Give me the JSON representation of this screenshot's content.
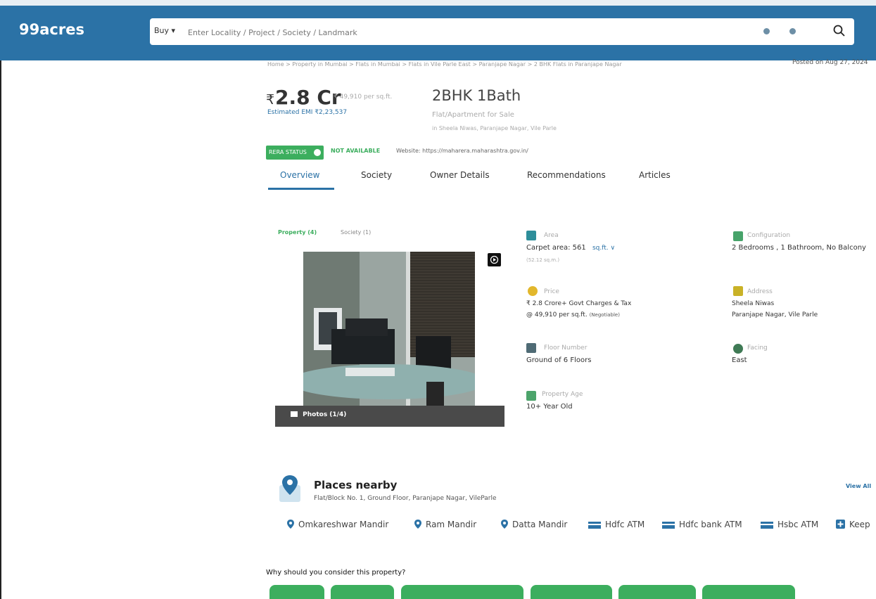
{
  "header": {
    "logo": "99acres",
    "buy_label": "Buy ▾",
    "search_placeholder": "Enter Locality / Project / Society / Landmark",
    "search_icon": "search-icon",
    "mic_icon": "mic-icon",
    "location_icon": "location-icon",
    "brand_color": "#2b72a6"
  },
  "breadcrumb": "Home > Property in Mumbai > Flats in Mumbai > Flats in Vile Parle East > Paranjape Nagar > 2 BHK Flats in Paranjape Nagar",
  "posted": "Posted on Aug 27, 2024",
  "price": {
    "rupee": "₹",
    "amount": "2.8 Cr",
    "per_sqft": "₹ 49,910 per sq.ft.",
    "emi": "Estimated EMI ₹2,23,537"
  },
  "config": {
    "title": "2BHK 1Bath",
    "subtitle": "Flat/Apartment for Sale",
    "location": "in Sheela Niwas, Paranjape Nagar, Vile Parle"
  },
  "rera": {
    "badge": "RERA STATUS",
    "status": "NOT AVAILABLE",
    "website": "Website: https://maharera.maharashtra.gov.in/",
    "accent_color": "#3cae5e"
  },
  "tabs": [
    {
      "label": "Overview",
      "active": true
    },
    {
      "label": "Society"
    },
    {
      "label": "Owner Details"
    },
    {
      "label": "Recommendations"
    },
    {
      "label": "Articles"
    }
  ],
  "photo_tabs": [
    "Property (4)",
    "Society (1)"
  ],
  "photos_label": "Photos (1/4)",
  "details": {
    "area": {
      "label": "Area",
      "value": "Carpet area: 561",
      "unit": "sq.ft. ∨",
      "sub": "(52.12 sq.m.)"
    },
    "configuration": {
      "label": "Configuration",
      "value": "2 Bedrooms , 1 Bathroom, No Balcony"
    },
    "price": {
      "label": "Price",
      "value": "₹ 2.8 Crore+ Govt Charges & Tax",
      "value2": "@ 49,910 per sq.ft.",
      "negotiable": "(Negotiable)"
    },
    "address": {
      "label": "Address",
      "value": "Sheela Niwas",
      "value2": "Paranjape Nagar, Vile Parle"
    },
    "floor": {
      "label": "Floor Number",
      "value": "Ground of 6 Floors"
    },
    "facing": {
      "label": "Facing",
      "value": "East"
    },
    "age": {
      "label": "Property Age",
      "value": "10+ Year Old"
    }
  },
  "places": {
    "title": "Places nearby",
    "address": "Flat/Block No. 1, Ground Floor, Paranjape Nagar, VileParle",
    "view_all": "View All",
    "items": [
      {
        "name": "Omkareshwar Mandir",
        "icon": "location-pin-icon"
      },
      {
        "name": "Ram Mandir",
        "icon": "location-pin-icon"
      },
      {
        "name": "Datta Mandir",
        "icon": "location-pin-icon"
      },
      {
        "name": "Hdfc ATM",
        "icon": "atm-icon"
      },
      {
        "name": "Hdfc bank ATM",
        "icon": "atm-icon"
      },
      {
        "name": "Hsbc ATM",
        "icon": "atm-icon"
      },
      {
        "name": "Keep",
        "icon": "plus-icon"
      }
    ]
  },
  "why": "Why should you consider this property?"
}
